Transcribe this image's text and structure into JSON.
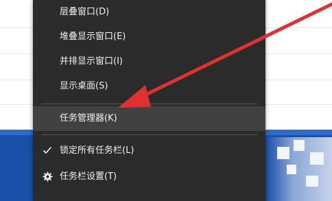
{
  "colors": {
    "menu_bg": "#2b2b2b",
    "menu_hover": "#414141",
    "menu_text": "#f2f2f2",
    "taskbar": "#1a4fa8",
    "arrow": "#e03131"
  },
  "context_menu": {
    "items": [
      {
        "label": "层叠窗口(D)"
      },
      {
        "label": "堆叠显示窗口(E)"
      },
      {
        "label": "并排显示窗口(I)"
      },
      {
        "label": "显示桌面(S)"
      },
      {
        "label": "任务管理器(K)",
        "highlighted": true
      },
      {
        "label": "锁定所有任务栏(L)",
        "checked": true,
        "icon": "check-icon"
      },
      {
        "label": "任务栏设置(T)",
        "icon": "gear-icon"
      }
    ]
  }
}
